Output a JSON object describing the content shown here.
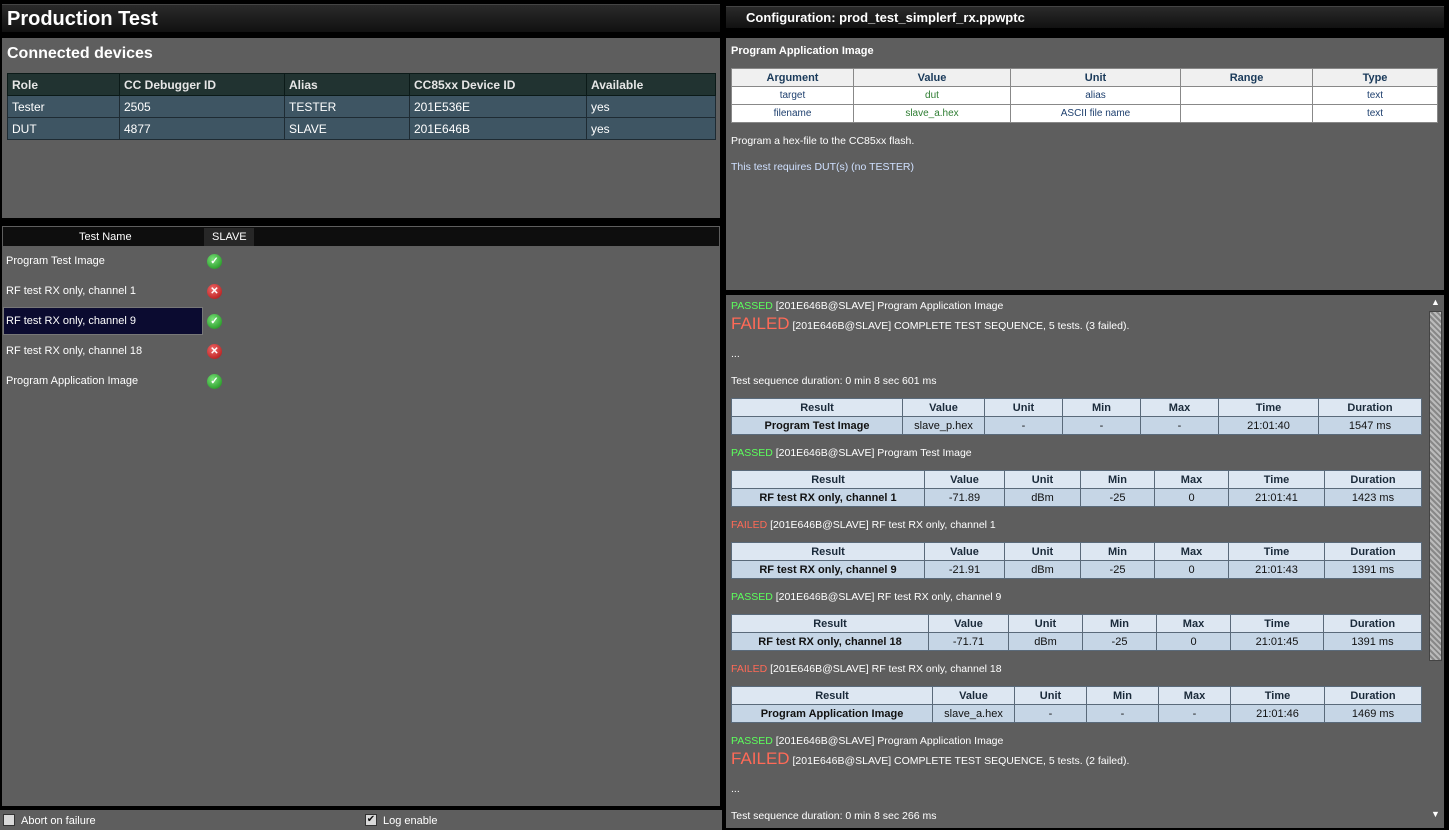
{
  "left_title": "Production Test",
  "right_title": "Configuration: prod_test_simplerf_rx.ppwptc",
  "devices": {
    "heading": "Connected devices",
    "columns": [
      "Role",
      "CC Debugger ID",
      "Alias",
      "CC85xx Device ID",
      "Available"
    ],
    "rows": [
      [
        "Tester",
        "2505",
        "TESTER",
        "201E536E",
        "yes"
      ],
      [
        "DUT",
        "4877",
        "SLAVE",
        "201E646B",
        "yes"
      ]
    ]
  },
  "tests": {
    "col_name": "Test Name",
    "col_slave": "SLAVE",
    "items": [
      {
        "name": "Program Test Image",
        "status": "pass"
      },
      {
        "name": "RF test RX only, channel 1",
        "status": "fail"
      },
      {
        "name": "RF test RX only, channel 9",
        "status": "pass",
        "selected": true
      },
      {
        "name": "RF test RX only, channel 18",
        "status": "fail"
      },
      {
        "name": "Program Application Image",
        "status": "pass"
      }
    ]
  },
  "bottom": {
    "abort_label": "Abort on failure",
    "abort_checked": false,
    "log_label": "Log enable",
    "log_checked": true
  },
  "config": {
    "subtitle": "Program Application Image",
    "columns": [
      "Argument",
      "Value",
      "Unit",
      "Range",
      "Type"
    ],
    "rows": [
      [
        "target",
        "dut",
        "alias",
        "",
        "text"
      ],
      [
        "filename",
        "slave_a.hex",
        "ASCII file name",
        "",
        "text"
      ]
    ],
    "desc1": "Program a hex-file to the CC85xx flash.",
    "desc2": "This test requires DUT(s) (no TESTER)"
  },
  "log": {
    "l1_status": "PASSED",
    "l1_text": "[201E646B@SLAVE] Program Application Image",
    "l2_status": "FAILED",
    "l2_text": "[201E646B@SLAVE] COMPLETE TEST SEQUENCE, 5 tests. (3 failed).",
    "l3": "...",
    "l4": "Test sequence duration: 0 min 8 sec 601 ms",
    "result_columns": [
      "Result",
      "Value",
      "Unit",
      "Min",
      "Max",
      "Time",
      "Duration"
    ],
    "t1": [
      "Program Test Image",
      "slave_p.hex",
      "-",
      "-",
      "-",
      "21:01:40",
      "1547 ms"
    ],
    "l5_status": "PASSED",
    "l5_text": "[201E646B@SLAVE] Program Test Image",
    "t2": [
      "RF test RX only, channel 1",
      "-71.89",
      "dBm",
      "-25",
      "0",
      "21:01:41",
      "1423 ms"
    ],
    "l6_status": "FAILED",
    "l6_text": "[201E646B@SLAVE] RF test RX only, channel 1",
    "t3": [
      "RF test RX only, channel 9",
      "-21.91",
      "dBm",
      "-25",
      "0",
      "21:01:43",
      "1391 ms"
    ],
    "l7_status": "PASSED",
    "l7_text": "[201E646B@SLAVE] RF test RX only, channel 9",
    "t4": [
      "RF test RX only, channel 18",
      "-71.71",
      "dBm",
      "-25",
      "0",
      "21:01:45",
      "1391 ms"
    ],
    "l8_status": "FAILED",
    "l8_text": "[201E646B@SLAVE] RF test RX only, channel 18",
    "t5": [
      "Program Application Image",
      "slave_a.hex",
      "-",
      "-",
      "-",
      "21:01:46",
      "1469 ms"
    ],
    "l9_status": "PASSED",
    "l9_text": "[201E646B@SLAVE] Program Application Image",
    "l10_status": "FAILED",
    "l10_text": "[201E646B@SLAVE] COMPLETE TEST SEQUENCE, 5 tests. (2 failed).",
    "l11": "...",
    "l12": "Test sequence duration: 0 min 8 sec 266 ms"
  },
  "colors": {
    "passed": "#5cff5c",
    "failed": "#ff6a57",
    "panel": "#5e5e5e",
    "selection": "#0b0b30"
  }
}
